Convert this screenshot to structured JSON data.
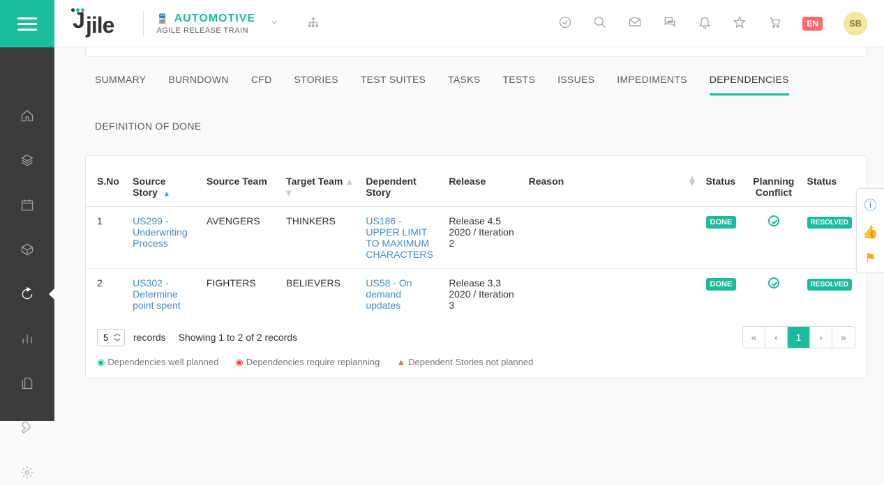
{
  "brand": "jile",
  "context": {
    "title": "AUTOMOTIVE",
    "subtitle": "AGILE RELEASE TRAIN"
  },
  "lang": "EN",
  "avatar": "SB",
  "tabs": [
    {
      "label": "SUMMARY",
      "active": false
    },
    {
      "label": "BURNDOWN",
      "active": false
    },
    {
      "label": "CFD",
      "active": false
    },
    {
      "label": "STORIES",
      "active": false
    },
    {
      "label": "TEST SUITES",
      "active": false
    },
    {
      "label": "TASKS",
      "active": false
    },
    {
      "label": "TESTS",
      "active": false
    },
    {
      "label": "ISSUES",
      "active": false
    },
    {
      "label": "IMPEDIMENTS",
      "active": false
    },
    {
      "label": "DEPENDENCIES",
      "active": true
    },
    {
      "label": "DEFINITION OF DONE",
      "active": false
    }
  ],
  "columns": {
    "sno": "S.No",
    "source_story": "Source Story",
    "source_team": "Source Team",
    "target_team": "Target Team",
    "dependent_story": "Dependent Story",
    "release": "Release",
    "reason": "Reason",
    "status": "Status",
    "planning_conflict": "Planning Conflict",
    "status2": "Status"
  },
  "rows": [
    {
      "sno": "1",
      "source_story": "US299 - Underwriting Process",
      "source_team": "AVENGERS",
      "target_team": "THINKERS",
      "dependent_story": "US186 - UPPER LIMIT TO MAXIMUM CHARACTERS",
      "release": "Release 4.5 2020 / Iteration 2",
      "reason": "",
      "status": "DONE",
      "status2": "RESOLVED"
    },
    {
      "sno": "2",
      "source_story": "US302 - Determine point spent",
      "source_team": "FIGHTERS",
      "target_team": "BELIEVERS",
      "dependent_story": "US58 - On demand updates",
      "release": "Release 3.3 2020 / Iteration 3",
      "reason": "",
      "status": "DONE",
      "status2": "RESOLVED"
    }
  ],
  "footer": {
    "records_select": "5",
    "records_label": "records",
    "showing": "Showing 1 to 2 of 2 records",
    "page": "1"
  },
  "legend": {
    "well": "Dependencies well planned",
    "replanning": "Dependencies require replanning",
    "notplanned": "Dependent Stories not planned"
  }
}
